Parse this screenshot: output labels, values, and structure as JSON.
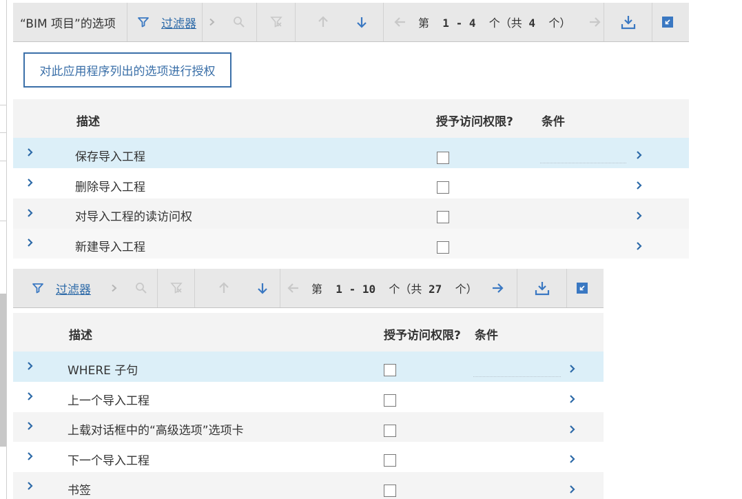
{
  "top_toolbar": {
    "title": "“BIM 项目”的选项",
    "filter_label": "过滤器",
    "page_prefix": "第",
    "page_from": "1",
    "page_dash": "-",
    "page_to": "4",
    "page_mid": "个（共",
    "page_total": "4",
    "page_suffix": "个）"
  },
  "authorize_button": "对此应用程序列出的选项进行授权",
  "table1": {
    "col_desc": "描述",
    "col_grant": "授予访问权限?",
    "col_cond": "条件",
    "rows": [
      {
        "label": "保存导入工程",
        "granted": false
      },
      {
        "label": "删除导入工程",
        "granted": false
      },
      {
        "label": "对导入工程的读访问权",
        "granted": false
      },
      {
        "label": "新建导入工程",
        "granted": false
      }
    ]
  },
  "bottom_toolbar": {
    "filter_label": "过滤器",
    "page_prefix": "第",
    "page_from": "1",
    "page_dash": "-",
    "page_to": "10",
    "page_mid": "个（共",
    "page_total": "27",
    "page_suffix": "个）"
  },
  "table2": {
    "col_desc": "描述",
    "col_grant": "授予访问权限?",
    "col_cond": "条件",
    "rows": [
      {
        "label": "WHERE 子句",
        "granted": false
      },
      {
        "label": "上一个导入工程",
        "granted": false
      },
      {
        "label": "上载对话框中的“高级选项”选项卡",
        "granted": false
      },
      {
        "label": "下一个导入工程",
        "granted": false
      },
      {
        "label": "书签",
        "granted": false
      }
    ]
  },
  "colors": {
    "accent": "#3a78c2",
    "disabled": "#c8c8c8",
    "selected_row": "#dceff8",
    "link": "#2d6aa8"
  },
  "icons": [
    "filter-icon",
    "chevron-right-icon",
    "search-icon",
    "clear-filter-icon",
    "sort-up-icon",
    "sort-down-icon",
    "prev-page-icon",
    "next-page-icon",
    "download-icon",
    "collapse-icon",
    "expand-row-icon",
    "row-detail-icon"
  ]
}
